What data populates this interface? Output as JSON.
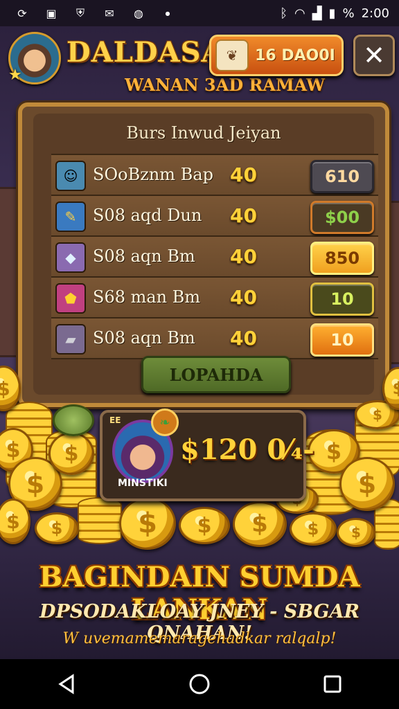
{
  "status_bar": {
    "icons_left": [
      "sync-icon",
      "message-icon",
      "shield-icon",
      "email-icon",
      "vk-icon",
      "dot-icon"
    ],
    "icons_right": [
      "bluetooth-icon",
      "wifi-icon",
      "signal-icon",
      "battery-icon"
    ],
    "percent_text": "%",
    "time": "2:00"
  },
  "header": {
    "title": "DALDASA!",
    "subtitle": "WANAN 3AD RAMAW",
    "currency_value": "16 DAO0I",
    "close_label": "✕"
  },
  "panel": {
    "title": "Burs Inwud Jeiyan",
    "rows": [
      {
        "name": "SOoBznm Bap",
        "cost": "40",
        "button": "610",
        "icon": "wizard-portrait-icon"
      },
      {
        "name": "S08 aqd Dun",
        "cost": "40",
        "button": "$00",
        "icon": "brush-icon"
      },
      {
        "name": "S08 aqn Bm",
        "cost": "40",
        "button": "850",
        "icon": "crystal-icon"
      },
      {
        "name": "S68 man Bm",
        "cost": "40",
        "button": "10",
        "icon": "gem-icon"
      },
      {
        "name": "S08 aqn Bm",
        "cost": "40",
        "button": "10",
        "icon": "stone-block-icon"
      }
    ],
    "confirm_label": "LOPAHDA"
  },
  "reward": {
    "small_tag": "EE",
    "amount": "$120 0⁄₄-",
    "name": "MINSTIKI"
  },
  "promo": {
    "line1": "BAGINDAIN SUMDA LANKAN",
    "line2": "DPSODAKLOAY JNEY - SBGAR QNAHAN!",
    "line3": "W uvemamemaragehadkar ralqalp!"
  },
  "colors": {
    "gold": "#ffd23a",
    "panel_wood": "#6b4a2c",
    "accent_orange": "#e07010"
  }
}
